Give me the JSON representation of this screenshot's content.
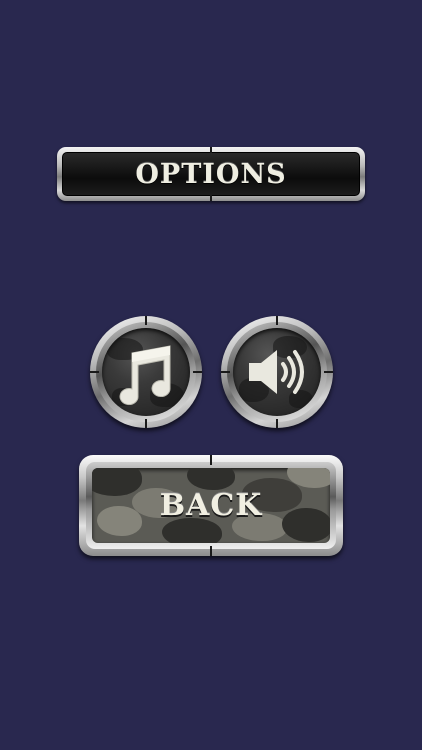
{
  "screen": {
    "background": "#29284f"
  },
  "title": {
    "label": "OPTIONS"
  },
  "buttons": {
    "music": {
      "icon": "music-note-icon"
    },
    "sound": {
      "icon": "speaker-icon"
    },
    "back": {
      "label": "BACK"
    }
  },
  "colors": {
    "plate_text": "#efeee2",
    "metal_light": "#f4f4f4",
    "metal_dark": "#6f6f6f",
    "button_face": "#1f1f1f",
    "camo_base": "#5b5b55"
  }
}
